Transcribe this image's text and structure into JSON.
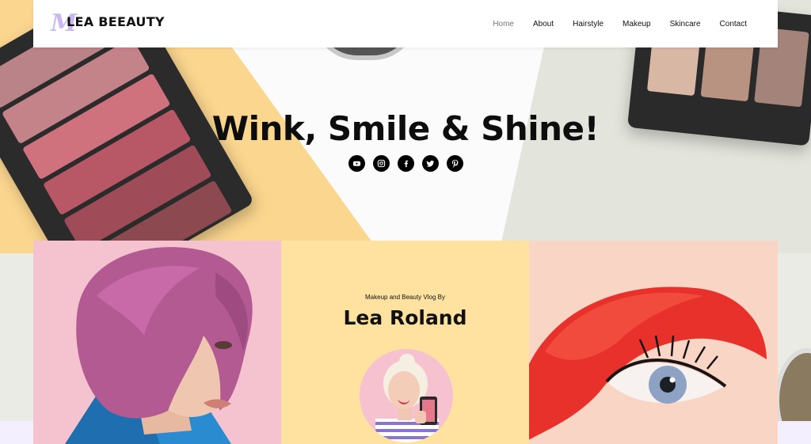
{
  "brand": {
    "name": "LEA BEEAUTY",
    "mark": "M"
  },
  "nav": [
    {
      "label": "Home",
      "active": true
    },
    {
      "label": "About",
      "active": false
    },
    {
      "label": "Hairstyle",
      "active": false
    },
    {
      "label": "Makeup",
      "active": false
    },
    {
      "label": "Skincare",
      "active": false
    },
    {
      "label": "Contact",
      "active": false
    }
  ],
  "hero": {
    "title": "Wink, Smile & Shine!"
  },
  "socials": [
    "youtube-icon",
    "instagram-icon",
    "facebook-icon",
    "twitter-icon",
    "pinterest-icon"
  ],
  "vlog": {
    "subtitle": "Makeup and Beauty Vlog By",
    "name": "Lea Roland"
  },
  "colors": {
    "accent_yellow": "#ffe2a0",
    "hero_yellow": "#fbd68f",
    "pink": "#f4c3cf",
    "lavender": "#cdb7f2",
    "text": "#111111"
  }
}
